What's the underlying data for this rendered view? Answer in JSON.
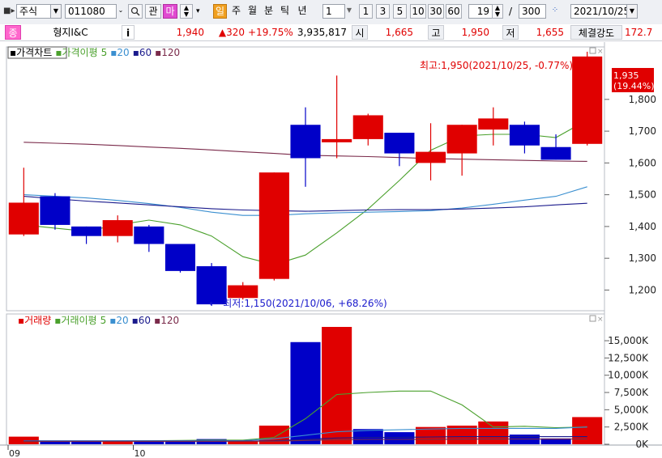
{
  "toolbar": {
    "market": "주식",
    "code": "011080",
    "btn_gwan": "관",
    "btn_ma": "마",
    "period_tabs": [
      "일",
      "주",
      "월",
      "분",
      "틱",
      "년"
    ],
    "interval_value": "1",
    "quick_intervals": [
      "1",
      "3",
      "5",
      "10",
      "30",
      "60"
    ],
    "count_value": "19",
    "slash": "/",
    "total_value": "300",
    "date_value": "2021/10/25"
  },
  "quote": {
    "badge": "종",
    "name": "형지I&C",
    "info": "i",
    "price": "1,940",
    "change": "▲320",
    "change_pct": "+19.75%",
    "volume": "3,935,817",
    "open_label": "시",
    "open": "1,665",
    "high_label": "고",
    "high": "1,950",
    "low_label": "저",
    "low": "1,655",
    "strength_label": "체결강도",
    "strength": "172.7"
  },
  "price_panel": {
    "tab": "가격차트",
    "ma_label": "가격이평",
    "ma_periods": [
      "5",
      "20",
      "60",
      "120"
    ],
    "high_annotation": "최고:1,950(2021/10/25, -0.77%)⟶",
    "low_annotation": "⟵최저:1,150(2021/10/06, +68.26%)",
    "current_price_tag": "1,935",
    "current_pct_tag": "(19.44%)"
  },
  "volume_panel": {
    "tab": "거래량",
    "ma_label": "거래이평",
    "ma_periods": [
      "5",
      "20",
      "60",
      "120"
    ]
  },
  "x_axis_labels": [
    {
      "label": "09",
      "index": 0
    },
    {
      "label": "10",
      "index": 4
    }
  ],
  "colors": {
    "up": "#e00000",
    "down": "#0000c8",
    "ma5": "#4aa02c",
    "ma20": "#3a8fd0",
    "ma60": "#1a1a8c",
    "ma120": "#7a2a4a",
    "vol_ma5": "#4aa02c"
  },
  "chart_data": [
    {
      "type": "candlestick",
      "title": "",
      "ylim": [
        1140,
        1960
      ],
      "y_ticks": [
        1200,
        1300,
        1400,
        1500,
        1600,
        1700,
        1800
      ],
      "candles": [
        {
          "o": 1375,
          "h": 1585,
          "l": 1370,
          "c": 1475
        },
        {
          "o": 1495,
          "h": 1505,
          "l": 1390,
          "c": 1405
        },
        {
          "o": 1400,
          "h": 1400,
          "l": 1345,
          "c": 1370
        },
        {
          "o": 1370,
          "h": 1435,
          "l": 1350,
          "c": 1420
        },
        {
          "o": 1400,
          "h": 1405,
          "l": 1320,
          "c": 1345
        },
        {
          "o": 1345,
          "h": 1345,
          "l": 1255,
          "c": 1260
        },
        {
          "o": 1275,
          "h": 1285,
          "l": 1150,
          "c": 1155
        },
        {
          "o": 1175,
          "h": 1225,
          "l": 1170,
          "c": 1215
        },
        {
          "o": 1235,
          "h": 1570,
          "l": 1230,
          "c": 1570
        },
        {
          "o": 1720,
          "h": 1775,
          "l": 1525,
          "c": 1615
        },
        {
          "o": 1665,
          "h": 1875,
          "l": 1615,
          "c": 1675
        },
        {
          "o": 1675,
          "h": 1755,
          "l": 1655,
          "c": 1750
        },
        {
          "o": 1695,
          "h": 1695,
          "l": 1590,
          "c": 1630
        },
        {
          "o": 1600,
          "h": 1725,
          "l": 1545,
          "c": 1635
        },
        {
          "o": 1630,
          "h": 1720,
          "l": 1560,
          "c": 1720
        },
        {
          "o": 1705,
          "h": 1775,
          "l": 1655,
          "c": 1740
        },
        {
          "o": 1720,
          "h": 1730,
          "l": 1630,
          "c": 1655
        },
        {
          "o": 1650,
          "h": 1690,
          "l": 1610,
          "c": 1610
        },
        {
          "o": 1660,
          "h": 1950,
          "l": 1655,
          "c": 1935
        }
      ],
      "ma": {
        "5": [
          1405,
          1395,
          1385,
          1405,
          1420,
          1405,
          1370,
          1305,
          1280,
          1310,
          1380,
          1455,
          1545,
          1640,
          1685,
          1690,
          1690,
          1680,
          1735
        ],
        "20": [
          1500,
          1495,
          1490,
          1482,
          1472,
          1460,
          1445,
          1435,
          1435,
          1440,
          1443,
          1445,
          1447,
          1450,
          1458,
          1470,
          1483,
          1495,
          1525
        ],
        "60": [
          1495,
          1487,
          1480,
          1474,
          1468,
          1462,
          1456,
          1452,
          1450,
          1448,
          1450,
          1452,
          1453,
          1453,
          1455,
          1458,
          1462,
          1468,
          1473
        ],
        "120": [
          1665,
          1662,
          1659,
          1655,
          1650,
          1646,
          1641,
          1635,
          1630,
          1624,
          1622,
          1620,
          1617,
          1614,
          1612,
          1610,
          1608,
          1606,
          1605
        ]
      }
    },
    {
      "type": "bar",
      "title": "",
      "ylim": [
        0,
        17000
      ],
      "y_ticks": [
        0,
        2500,
        5000,
        7500,
        10000,
        12500,
        15000
      ],
      "y_tick_labels": [
        "0K",
        "2,500K",
        "5,000K",
        "7,500K",
        "10,000K",
        "12,500K",
        "15,000K"
      ],
      "values": [
        1100,
        450,
        420,
        450,
        450,
        520,
        750,
        520,
        2700,
        14800,
        17000,
        2200,
        1750,
        2500,
        2700,
        3300,
        1400,
        850,
        3935
      ],
      "directions": [
        "up",
        "down",
        "down",
        "up",
        "down",
        "down",
        "down",
        "up",
        "up",
        "down",
        "up",
        "down",
        "down",
        "up",
        "up",
        "up",
        "down",
        "down",
        "up"
      ],
      "ma": {
        "5": [
          400,
          420,
          450,
          480,
          500,
          550,
          600,
          600,
          1000,
          3700,
          7200,
          7500,
          7700,
          7700,
          5700,
          2500,
          2600,
          2400,
          2500
        ],
        "20": [
          500,
          500,
          500,
          500,
          500,
          500,
          510,
          520,
          800,
          1300,
          1800,
          2000,
          2100,
          2200,
          2300,
          2300,
          2300,
          2300,
          2500
        ],
        "60": [
          450,
          450,
          450,
          450,
          450,
          450,
          450,
          460,
          500,
          700,
          900,
          1000,
          1000,
          1050,
          1100,
          1100,
          1100,
          1100,
          1100
        ],
        "120": [
          420,
          420,
          420,
          420,
          420,
          420,
          420,
          430,
          450,
          550,
          650,
          700,
          700,
          720,
          740,
          750,
          750,
          750,
          760
        ]
      }
    }
  ]
}
